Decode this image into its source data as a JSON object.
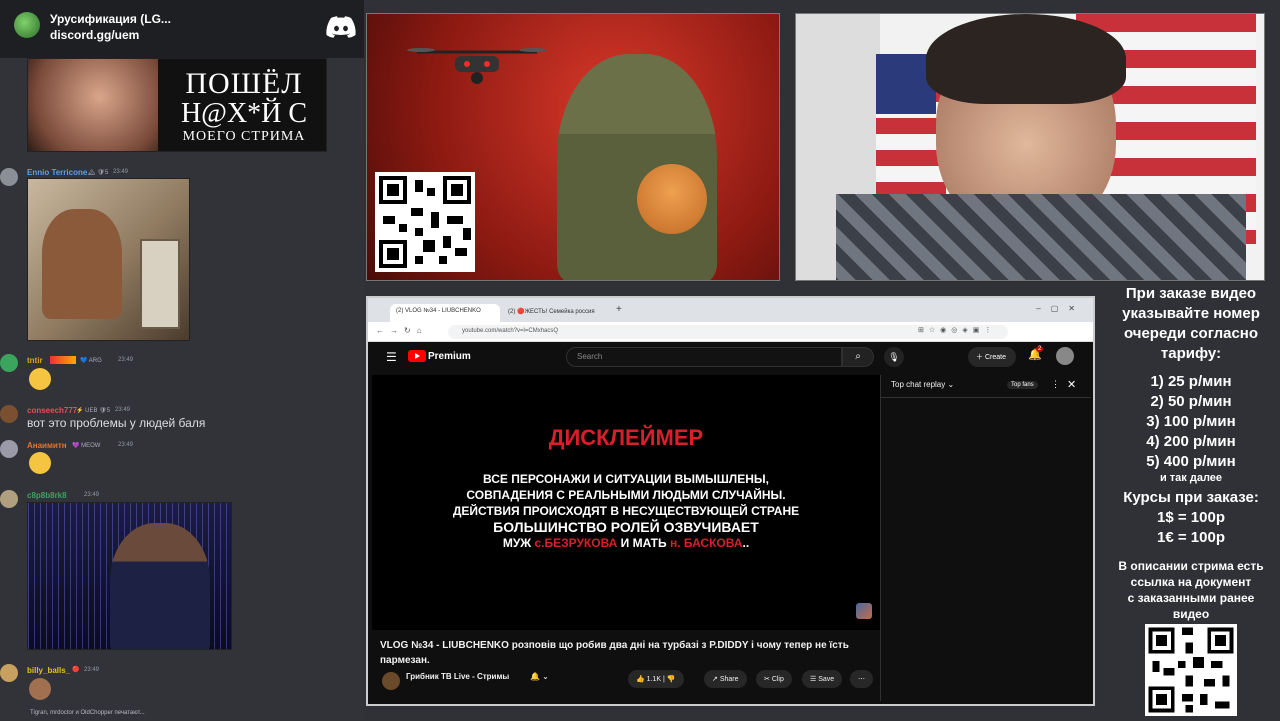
{
  "chat": {
    "server_name": "Урусификация (LG...",
    "server_invite": "discord.gg/uem",
    "meme_text": {
      "line1": "ПОШЁЛ",
      "line2": "Н@Х*Й С",
      "line3": "МОЕГО СТРИМА"
    },
    "messages": [
      {
        "user": "Ennio Terricone",
        "badges": "🏔 🛡5",
        "time": "23:49",
        "user_color": "#5aa0e6"
      },
      {
        "user": "tntir",
        "badges": "💙 ARG",
        "time": "23:49",
        "user_color": "#e3a11a"
      },
      {
        "user": "conseech777",
        "badges": "⚡ UEB 🛡5",
        "time": "23:49",
        "text": "вот это проблемы у людей баля",
        "user_color": "#e35050"
      },
      {
        "user": "Анаимитн",
        "badges": "💜 MEOW",
        "time": "23:49",
        "user_color": "#e8732a"
      },
      {
        "user": "c8p8b8rk8",
        "badges": "",
        "time": "23:49",
        "user_color": "#3ba55d"
      },
      {
        "user": "billy_balls_",
        "badges": "🔴",
        "time": "23:49",
        "user_color": "#e3c31a"
      }
    ],
    "typing": "Tigran, mrdoctor и OldChopper печатают..."
  },
  "browser": {
    "tabs": [
      {
        "label": "(2) VLOG №34 - LIUBCHENKO"
      },
      {
        "label": "(2) 🔴ЖЕСТЬ! Семейка россия"
      }
    ],
    "url": "youtube.com/watch?v=l=CMxhacsQ",
    "youtube": {
      "brand": "Premium",
      "search_placeholder": "Search",
      "create_label": "Create",
      "notifications": "2",
      "disclaimer": {
        "title": "ДИСКЛЕЙМЕР",
        "line1": "ВСЕ ПЕРСОНАЖИ И СИТУАЦИИ ВЫМЫШЛЕНЫ,",
        "line2": "СОВПАДЕНИЯ С РЕАЛЬНЫМИ ЛЮДЬМИ СЛУЧАЙНЫ.",
        "line3": "ДЕЙСТВИЯ ПРОИСХОДЯТ В НЕСУЩЕСТВУЮЩЕЙ СТРАНЕ",
        "line4": "БОЛЬШИНСТВО РОЛЕЙ ОЗВУЧИВАЕТ",
        "line5_a": "МУЖ ",
        "line5_b": "с.БЕЗРУКОВА",
        "line5_c": " И МАТЬ ",
        "line5_d": "н. БАСКОВА",
        "line5_e": ".."
      },
      "video_title": "VLOG №34 - LIUBCHENKO розповів що робив два дні на турбазі з P.DIDDY і чому тепер не їсть пармезан.",
      "channel": "Грибник ТВ Live - Стримы",
      "subs": "",
      "likes": "1.1K",
      "share": "Share",
      "clip": "Clip",
      "save": "Save",
      "chat_mode": "Top chat replay",
      "top_fans": "Top fans"
    }
  },
  "panel": {
    "intro": [
      "При заказе видео",
      "указывайте номер",
      "очереди согласно",
      "тарифу:"
    ],
    "prices": [
      "1) 25 р/мин",
      "2) 50 р/мин",
      "3) 100 р/мин",
      "4) 200 р/мин",
      "5) 400 р/мин"
    ],
    "etc": "и так далее",
    "rates_title": "Курсы при заказе:",
    "rates": [
      "1$ = 100р",
      "1€ = 100р"
    ],
    "desc": [
      "В описании стрима есть",
      "ссылка на документ",
      "с заказанными ранее",
      "видео"
    ]
  },
  "colors": {
    "chat_bg": "#313338",
    "youtube_red": "#ff0000",
    "disclaimer_red": "#d8202a"
  }
}
